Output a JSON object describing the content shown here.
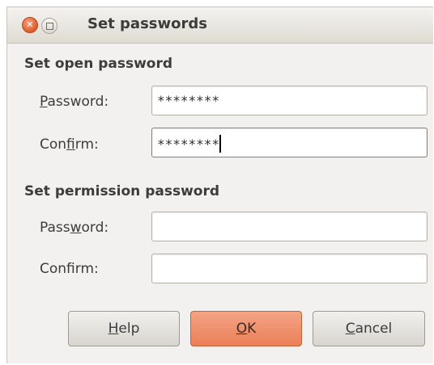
{
  "window": {
    "title": "Set passwords"
  },
  "open_password": {
    "heading": "Set open password",
    "password_label_mnemonic": "P",
    "password_label_rest": "assword:",
    "password_value": "********",
    "confirm_label_pre": "Con",
    "confirm_label_mnemonic": "f",
    "confirm_label_post": "irm:",
    "confirm_value": "********"
  },
  "permission_password": {
    "heading": "Set permission password",
    "password_label_pre": "Pass",
    "password_label_mnemonic": "w",
    "password_label_post": "ord:",
    "password_value": "",
    "confirm_label": "Confirm:",
    "confirm_value": ""
  },
  "buttons": {
    "help_mnemonic": "H",
    "help_rest": "elp",
    "ok_mnemonic": "O",
    "ok_rest": "K",
    "cancel_mnemonic": "C",
    "cancel_rest": "ancel"
  },
  "colors": {
    "close_button": "#e05a2a",
    "ok_button": "#ea7f57",
    "window_bg": "#f2f1f0"
  },
  "icons": {
    "close": "close-icon",
    "maximize": "maximize-icon"
  }
}
